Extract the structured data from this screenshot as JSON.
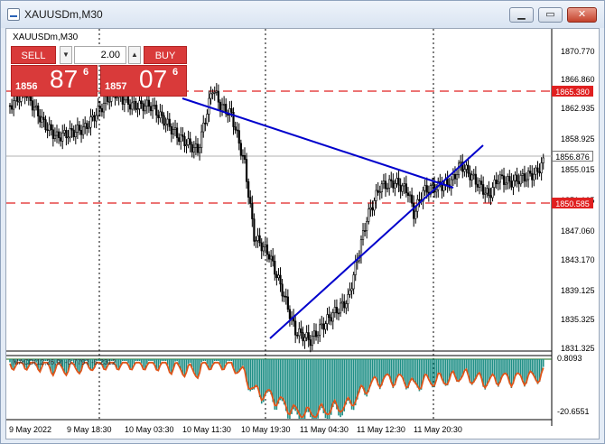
{
  "window": {
    "title": "XAUUSDm,M30",
    "controls": {
      "minimize": "▁",
      "maximize": "▭",
      "close": "✕"
    }
  },
  "chart": {
    "symbol_label": "XAUUSDm,M30",
    "trade_panel": {
      "sell_label": "SELL",
      "buy_label": "BUY",
      "lot": "2.00",
      "down_arrow": "▼",
      "up_arrow": "▲",
      "sell_price": {
        "prefix": "1856",
        "big": "87",
        "sup": "6"
      },
      "buy_price": {
        "prefix": "1857",
        "big": "07",
        "sup": "6"
      }
    },
    "price_axis": [
      "1870.770",
      "1866.860",
      "1862.935",
      "1858.925",
      "1855.015",
      "1851.105",
      "1847.060",
      "1843.170",
      "1839.125",
      "1835.325",
      "1831.325"
    ],
    "price_tags": {
      "upper_line": "1865.380",
      "current": "1856.876",
      "lower_line": "1850.585"
    },
    "time_axis": [
      "9 May 2022",
      "9 May 18:30",
      "10 May 03:30",
      "10 May 11:30",
      "10 May 19:30",
      "11 May 04:30",
      "11 May 12:30",
      "11 May 20:30"
    ],
    "indicator": {
      "label": "MACD(12,26,9) -0.7797 -5.2312",
      "axis_top": "0.8093",
      "axis_bottom": "-20.6551"
    },
    "colors": {
      "candle": "#000000",
      "trend_line": "#0000cc",
      "level_line": "#e02020",
      "histogram": "#1f8f86",
      "signal": "#e0551a",
      "tag_red": "#e02020"
    }
  }
}
